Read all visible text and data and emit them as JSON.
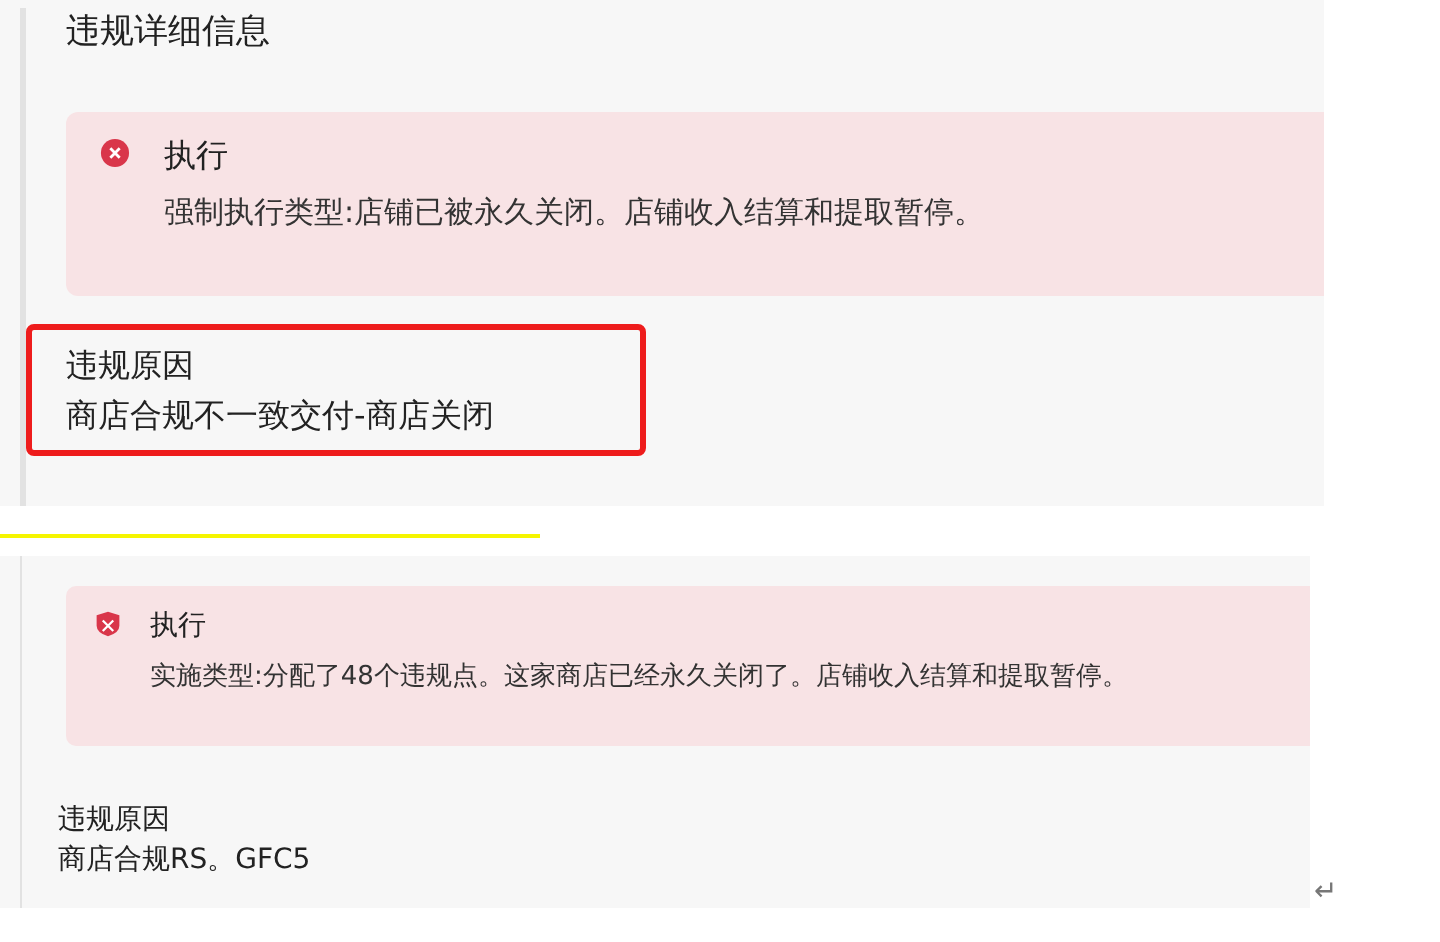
{
  "panels": [
    {
      "title": "违规详细信息",
      "alert": {
        "kind": "circle",
        "title": "执行",
        "message": "强制执行类型:店铺已被永久关闭。店铺收入结算和提取暂停。"
      },
      "reason": {
        "label": "违规原因",
        "value": "商店合规不一致交付-商店关闭",
        "highlighted": true
      }
    },
    {
      "alert": {
        "kind": "shield",
        "title": "执行",
        "message": "实施类型:分配了48个违规点。这家商店已经永久关闭了。店铺收入结算和提取暂停。"
      },
      "reason": {
        "label": "违规原因",
        "value": "商店合规RS。GFC5",
        "highlighted": false
      }
    }
  ],
  "return_mark": "↵"
}
